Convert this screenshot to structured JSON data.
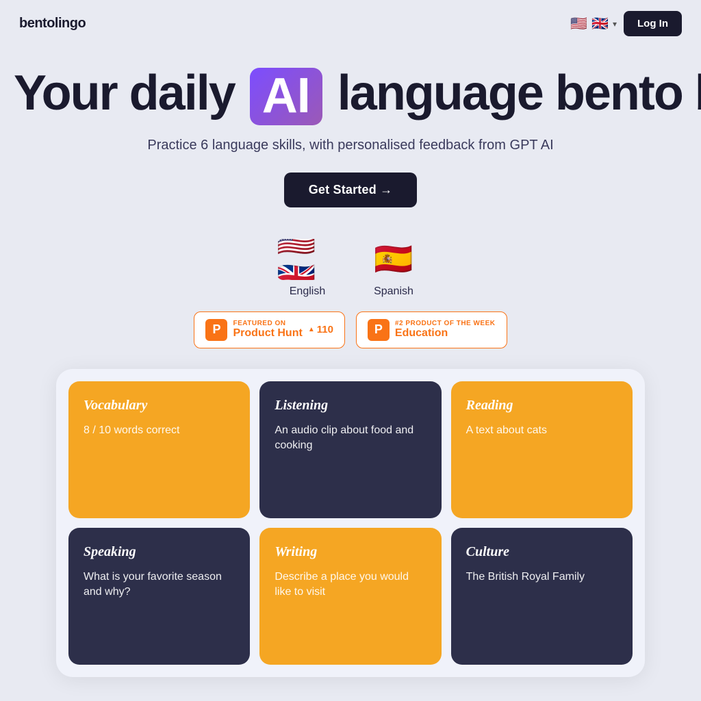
{
  "navbar": {
    "logo": "bentolingo",
    "lang_flag": "🇺🇸🇬🇧",
    "login_label": "Log In"
  },
  "hero": {
    "title_before": "Your daily",
    "ai_badge": "AI",
    "title_after": "language bento box",
    "subtitle": "Practice 6 language skills, with personalised feedback from GPT AI",
    "cta_label": "Get Started →"
  },
  "languages": [
    {
      "id": "english",
      "flag": "🇺🇸🇬🇧",
      "label": "English"
    },
    {
      "id": "spanish",
      "flag": "🇪🇸",
      "label": "Spanish"
    }
  ],
  "ph_badges": [
    {
      "id": "featured",
      "logo": "P",
      "label": "FEATURED ON",
      "name": "Product Hunt",
      "count": "110",
      "show_arrow": true
    },
    {
      "id": "education",
      "logo": "P",
      "label": "#2 PRODUCT OF THE WEEK",
      "name": "Education",
      "count": null,
      "show_arrow": false
    }
  ],
  "bento_cards": [
    {
      "id": "vocabulary",
      "title": "Vocabulary",
      "desc": "8 / 10 words correct",
      "theme": "orange"
    },
    {
      "id": "listening",
      "title": "Listening",
      "desc": "An audio clip about food and cooking",
      "theme": "dark"
    },
    {
      "id": "reading",
      "title": "Reading",
      "desc": "A text about cats",
      "theme": "orange"
    },
    {
      "id": "speaking",
      "title": "Speaking",
      "desc": "What is your favorite season and why?",
      "theme": "dark"
    },
    {
      "id": "writing",
      "title": "Writing",
      "desc": "Describe a place you would like to visit",
      "theme": "orange"
    },
    {
      "id": "culture",
      "title": "Culture",
      "desc": "The British Royal Family",
      "theme": "dark"
    }
  ]
}
